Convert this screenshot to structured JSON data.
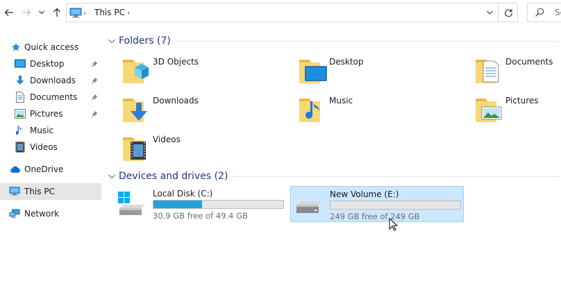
{
  "nav": {
    "back_icon": "back-arrow-icon",
    "forward_icon": "forward-arrow-icon",
    "recent_icon": "recent-locations-chevron-icon",
    "up_icon": "up-arrow-icon"
  },
  "address": {
    "location_icon": "this-pc-icon",
    "separator": "›",
    "crumb": "This PC",
    "trailing_separator": "›"
  },
  "search": {
    "placeholder": "Se"
  },
  "sidebar": {
    "items": [
      {
        "label": "Quick access",
        "icon": "star-icon"
      },
      {
        "label": "Desktop",
        "icon": "desktop-icon",
        "pinned": true
      },
      {
        "label": "Downloads",
        "icon": "download-arrow-icon",
        "pinned": true
      },
      {
        "label": "Documents",
        "icon": "documents-icon",
        "pinned": true
      },
      {
        "label": "Pictures",
        "icon": "pictures-icon",
        "pinned": true
      },
      {
        "label": "Music",
        "icon": "music-note-icon"
      },
      {
        "label": "Videos",
        "icon": "film-icon"
      },
      {
        "label": "OneDrive",
        "icon": "cloud-icon"
      },
      {
        "label": "This PC",
        "icon": "this-pc-icon",
        "selected": true
      },
      {
        "label": "Network",
        "icon": "network-icon"
      }
    ]
  },
  "folders": {
    "header": "Folders (7)",
    "items": [
      {
        "name": "3D Objects"
      },
      {
        "name": "Desktop"
      },
      {
        "name": "Documents"
      },
      {
        "name": "Downloads"
      },
      {
        "name": "Music"
      },
      {
        "name": "Pictures"
      },
      {
        "name": "Videos"
      }
    ]
  },
  "devices": {
    "header": "Devices and drives (2)",
    "items": [
      {
        "name": "Local Disk (C:)",
        "free_text": "30.9 GB free of 49.4 GB",
        "used_fraction": 0.375,
        "has_windows_logo": true
      },
      {
        "name": "New Volume (E:)",
        "free_text": "249 GB free of 249 GB",
        "used_fraction": 0.0,
        "selected": true
      }
    ]
  },
  "colors": {
    "accent": "#26a0da",
    "selection": "#cce8ff",
    "header_text": "#1e3287",
    "folder_yellow": "#f8d775"
  }
}
